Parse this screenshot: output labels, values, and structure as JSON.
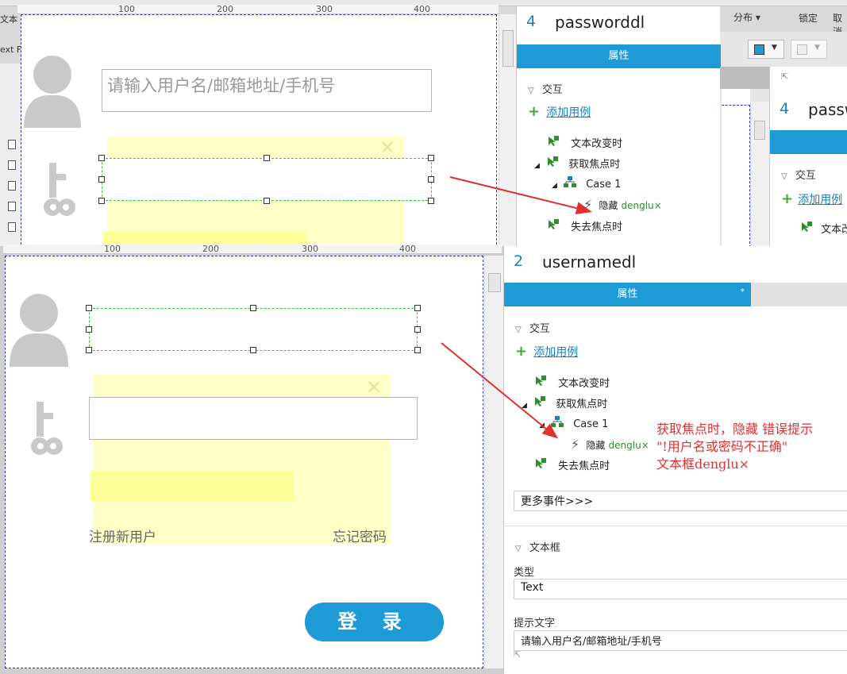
{
  "toolbar": {
    "distribute_label": "分布 ▾",
    "lock_label": "锁定",
    "cancel_label": "取消",
    "text_label": "文本",
    "text_f_label": "ext F"
  },
  "top_canvas": {
    "ruler_marks": [
      "100",
      "200",
      "300",
      "400"
    ],
    "username_placeholder": "请输入用户名/邮箱地址/手机号"
  },
  "top_panel": {
    "number": "4",
    "title": "passworddl",
    "tab_label": "属性",
    "section_label": "交互",
    "add_case_label": "添加用例",
    "events": {
      "text_changed": "文本改变时",
      "focus": "获取焦点时",
      "case": "Case 1",
      "hide_action": "隐藏",
      "hide_target": "denglu×",
      "blur": "失去焦点时"
    }
  },
  "right_panel": {
    "number": "4",
    "title_partial": "passw",
    "section_label": "交互",
    "add_case_label": "添加用例",
    "event_partial": "文本改"
  },
  "bottom_canvas": {
    "ruler_marks": [
      "100",
      "200",
      "300",
      "400"
    ],
    "register_label": "注册新用户",
    "forgot_label": "忘记密码",
    "login_label": "登 录"
  },
  "bottom_panel": {
    "number": "2",
    "title": "usernamedl",
    "tab_label": "属性",
    "tab_star": "*",
    "section_label": "交互",
    "add_case_label": "添加用例",
    "events": {
      "text_changed": "文本改变时",
      "focus": "获取焦点时",
      "case": "Case 1",
      "hide_action": "隐藏",
      "hide_target": "denglu×",
      "blur": "失去焦点时"
    },
    "more_events_label": "更多事件>>>",
    "textbox_section_label": "文本框",
    "type_label": "类型",
    "type_value": "Text",
    "hint_label": "提示文字",
    "hint_value": "请输入用户名/邮箱地址/手机号"
  },
  "annotation": {
    "line1": "获取焦点时，隐藏 错误提示",
    "line2": "\"!用户名或密码不正确\"",
    "line3": "文本框denglu×"
  },
  "colors": {
    "accent": "#1e9bd7",
    "annotation": "#e03030",
    "selection": "#33cc33"
  }
}
